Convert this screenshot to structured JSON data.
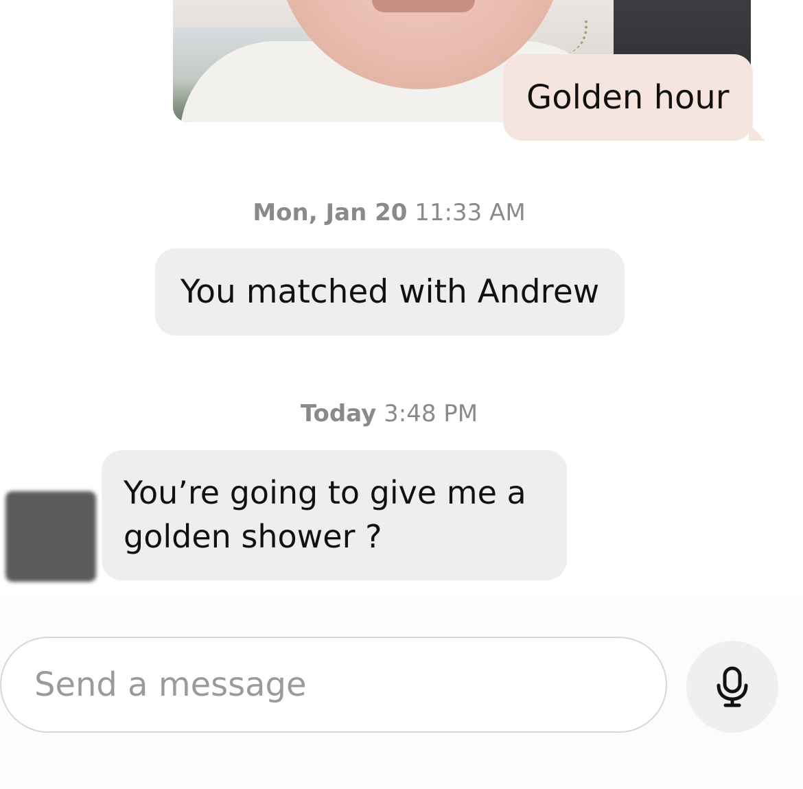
{
  "messages": {
    "outgoing_caption": "Golden hour",
    "timestamp_1": {
      "day": "Mon, Jan 20",
      "time": "11:33 AM"
    },
    "match_notice": "You matched with Andrew",
    "timestamp_2": {
      "day": "Today",
      "time": "3:48 PM"
    },
    "incoming_text": "You’re going to give me a golden shower ?"
  },
  "composer": {
    "placeholder": "Send a message",
    "mic_icon": "microphone-icon"
  },
  "colors": {
    "outgoing_bubble": "#f6e5df",
    "system_bubble": "#eeeef0",
    "incoming_bubble": "#eeeef0",
    "timestamp_text": "#8a8a8a"
  }
}
